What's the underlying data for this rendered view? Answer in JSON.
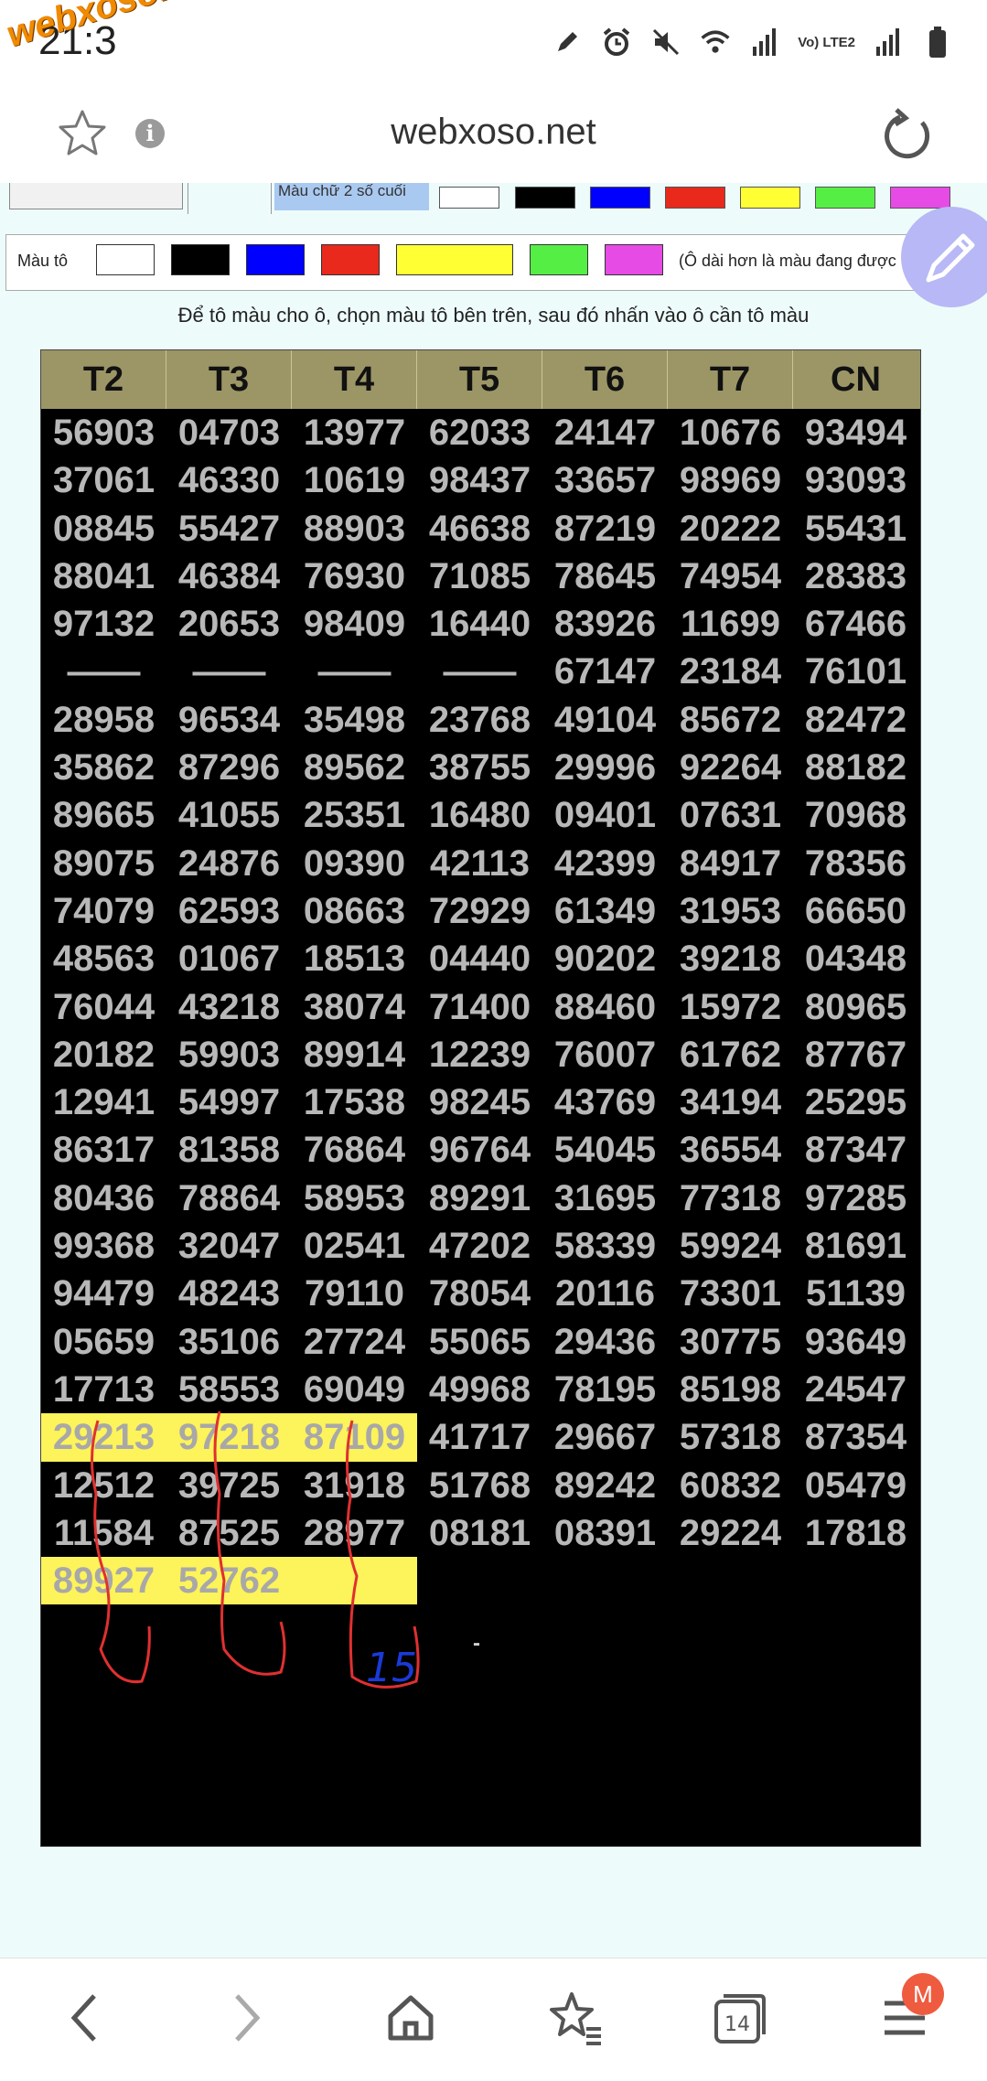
{
  "status": {
    "time": "21:3",
    "watermark": "webxoso.net",
    "network": "Vo) LTE2"
  },
  "browser": {
    "url": "webxoso.net"
  },
  "top_partial": {
    "label": "Màu chữ 2 số cuối"
  },
  "palette": {
    "label": "Màu tô",
    "note": "(Ô dài hơn là màu đang được chọn)",
    "colors": [
      "#ffffff",
      "#000000",
      "#0000ff",
      "#e8291c",
      "#ffff33",
      "#55ee44",
      "#e64be6"
    ]
  },
  "instruction": "Để tô màu cho ô, chọn màu tô bên trên, sau đó nhấn vào ô cần tô màu",
  "table": {
    "headers": [
      "T2",
      "T3",
      "T4",
      "T5",
      "T6",
      "T7",
      "CN"
    ],
    "rows": [
      [
        "56903",
        "04703",
        "13977",
        "62033",
        "24147",
        "10676",
        "93494"
      ],
      [
        "37061",
        "46330",
        "10619",
        "98437",
        "33657",
        "98969",
        "93093"
      ],
      [
        "08845",
        "55427",
        "88903",
        "46638",
        "87219",
        "20222",
        "55431"
      ],
      [
        "88041",
        "46384",
        "76930",
        "71085",
        "78645",
        "74954",
        "28383"
      ],
      [
        "97132",
        "20653",
        "98409",
        "16440",
        "83926",
        "11699",
        "67466"
      ],
      [
        "——",
        "——",
        "——",
        "——",
        "67147",
        "23184",
        "76101"
      ],
      [
        "28958",
        "96534",
        "35498",
        "23768",
        "49104",
        "85672",
        "82472"
      ],
      [
        "35862",
        "87296",
        "89562",
        "38755",
        "29996",
        "92264",
        "88182"
      ],
      [
        "89665",
        "41055",
        "25351",
        "16480",
        "09401",
        "07631",
        "70968"
      ],
      [
        "89075",
        "24876",
        "09390",
        "42113",
        "42399",
        "84917",
        "78356"
      ],
      [
        "74079",
        "62593",
        "08663",
        "72929",
        "61349",
        "31953",
        "66650"
      ],
      [
        "48563",
        "01067",
        "18513",
        "04440",
        "90202",
        "39218",
        "04348"
      ],
      [
        "76044",
        "43218",
        "38074",
        "71400",
        "88460",
        "15972",
        "80965"
      ],
      [
        "20182",
        "59903",
        "89914",
        "12239",
        "76007",
        "61762",
        "87767"
      ],
      [
        "12941",
        "54997",
        "17538",
        "98245",
        "43769",
        "34194",
        "25295"
      ],
      [
        "86317",
        "81358",
        "76864",
        "96764",
        "54045",
        "36554",
        "87347"
      ],
      [
        "80436",
        "78864",
        "58953",
        "89291",
        "31695",
        "77318",
        "97285"
      ],
      [
        "99368",
        "32047",
        "02541",
        "47202",
        "58339",
        "59924",
        "81691"
      ],
      [
        "94479",
        "48243",
        "79110",
        "78054",
        "20116",
        "73301",
        "51139"
      ],
      [
        "05659",
        "35106",
        "27724",
        "55065",
        "29436",
        "30775",
        "93649"
      ],
      [
        "17713",
        "58553",
        "69049",
        "49968",
        "78195",
        "85198",
        "24547"
      ],
      [
        "29213",
        "97218",
        "87109",
        "41717",
        "29667",
        "57318",
        "87354"
      ],
      [
        "12512",
        "39725",
        "31918",
        "51768",
        "89242",
        "60832",
        "05479"
      ],
      [
        "11584",
        "87525",
        "28977",
        "08181",
        "08391",
        "29224",
        "17818"
      ],
      [
        "89927",
        "52762",
        "",
        "",
        "",
        "",
        ""
      ]
    ],
    "highlighted": [
      "21-0",
      "21-1",
      "21-2",
      "24-0",
      "24-1",
      "24-2"
    ],
    "highlight_color": "#fdf35a",
    "handwritten_note": "15",
    "footer_mark": "-"
  },
  "navbar": {
    "tabs_count": "14",
    "avatar_letter": "M"
  }
}
